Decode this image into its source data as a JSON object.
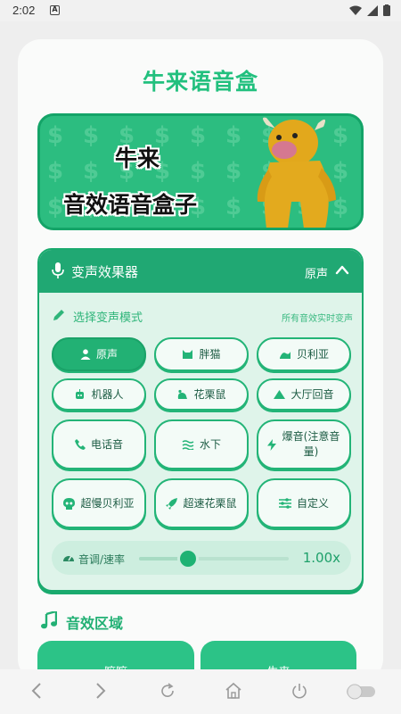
{
  "status_bar": {
    "time": "2:02",
    "notification_icon": "A"
  },
  "app": {
    "title": "牛来语音盒"
  },
  "banner": {
    "line1": "牛来",
    "line2": "音效语音盒子"
  },
  "voice_panel": {
    "title": "变声效果器",
    "current_effect": "原声",
    "mode_label": "选择变声模式",
    "mode_hint": "所有音效实时变声",
    "modes": [
      {
        "label": "原声",
        "icon": "person-icon",
        "active": true
      },
      {
        "label": "胖猫",
        "icon": "cat-icon",
        "active": false
      },
      {
        "label": "贝利亚",
        "icon": "wave-icon",
        "active": false
      },
      {
        "label": "机器人",
        "icon": "robot-icon",
        "active": false
      },
      {
        "label": "花栗鼠",
        "icon": "chipmunk-icon",
        "active": false
      },
      {
        "label": "大厅回音",
        "icon": "mountain-icon",
        "active": false
      },
      {
        "label": "电话音",
        "icon": "phone-icon",
        "active": false
      },
      {
        "label": "水下",
        "icon": "water-icon",
        "active": false
      },
      {
        "label": "爆音(注意音量)",
        "icon": "bolt-icon",
        "active": false
      },
      {
        "label": "超慢贝利亚",
        "icon": "skull-icon",
        "active": false
      },
      {
        "label": "超速花栗鼠",
        "icon": "rocket-icon",
        "active": false
      },
      {
        "label": "自定义",
        "icon": "sliders-icon",
        "active": false
      }
    ],
    "pitch_label": "音调/速率",
    "pitch_value": "1.00x",
    "pitch_fraction": 0.33
  },
  "sfx_area": {
    "title": "音效区域",
    "buttons": [
      "嘛嘛",
      "牛来"
    ]
  },
  "colors": {
    "accent": "#22b174",
    "accent_dark": "#1aa268",
    "panel_bg": "#dff4ea"
  }
}
